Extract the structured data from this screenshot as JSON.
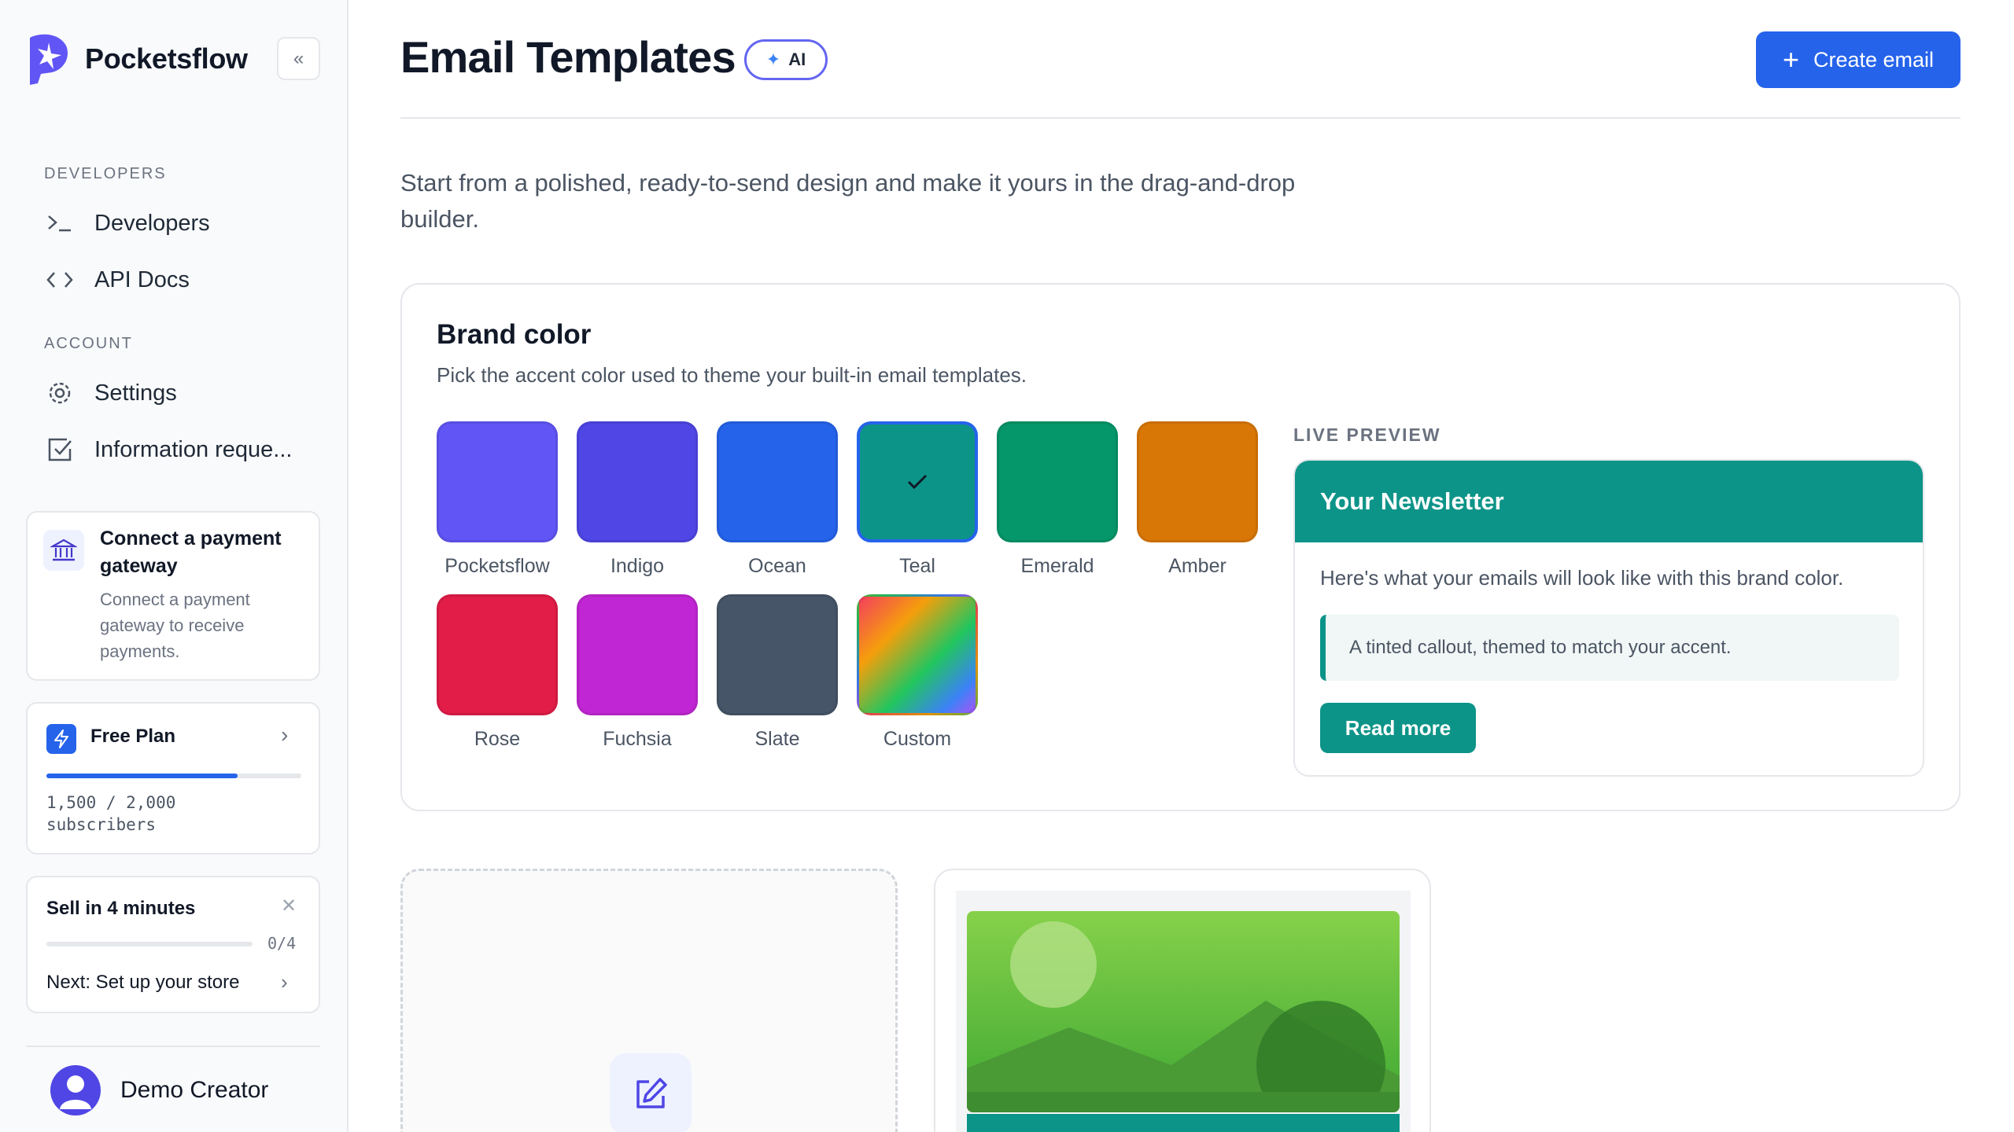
{
  "sidebar": {
    "brand_name": "Pocketsflow",
    "sections": [
      {
        "label": "DEVELOPERS",
        "items": [
          {
            "label": "Developers",
            "icon": "terminal-icon"
          },
          {
            "label": "API Docs",
            "icon": "code-icon"
          }
        ]
      },
      {
        "label": "ACCOUNT",
        "items": [
          {
            "label": "Settings",
            "icon": "gear-icon"
          },
          {
            "label": "Information reque...",
            "icon": "checkbox-icon"
          }
        ]
      }
    ],
    "payment_card": {
      "title": "Connect a payment gateway",
      "description": "Connect a payment gateway to receive payments.",
      "icon": "bank-icon"
    },
    "plan_card": {
      "title": "Free Plan",
      "usage_text": "1,500 / 2,000 subscribers",
      "used": 1500,
      "limit": 2000,
      "icon": "bolt-icon"
    },
    "sell_card": {
      "title": "Sell in 4 minutes",
      "progress_text": "0/4",
      "progress": 0,
      "next_step": "Next: Set up your store"
    },
    "user": {
      "name": "Demo Creator"
    }
  },
  "header": {
    "title": "Email Templates",
    "ai_badge": "AI",
    "create_button": "Create email"
  },
  "intro": "Start from a polished, ready-to-send design and make it yours in the drag-and-drop builder.",
  "brand_color": {
    "title": "Brand color",
    "description": "Pick the accent color used to theme your built-in email templates.",
    "selected": "Teal",
    "swatches": [
      {
        "label": "Pocketsflow",
        "color": "#6155f5"
      },
      {
        "label": "Indigo",
        "color": "#4f46e5"
      },
      {
        "label": "Ocean",
        "color": "#2563eb"
      },
      {
        "label": "Teal",
        "color": "#0d9488"
      },
      {
        "label": "Emerald",
        "color": "#059669"
      },
      {
        "label": "Amber",
        "color": "#d97706"
      },
      {
        "label": "Rose",
        "color": "#e11d48"
      },
      {
        "label": "Fuchsia",
        "color": "#c026d3"
      },
      {
        "label": "Slate",
        "color": "#475569"
      },
      {
        "label": "Custom",
        "color": "gradient"
      }
    ]
  },
  "preview": {
    "label": "LIVE PREVIEW",
    "heading": "Your Newsletter",
    "body": "Here's what your emails will look like with this brand color.",
    "callout": "A tinted callout, themed to match your accent.",
    "button": "Read more",
    "accent": "#0d9488"
  },
  "colors": {
    "primary": "#2563eb",
    "accent_ai": "#6366f1"
  }
}
